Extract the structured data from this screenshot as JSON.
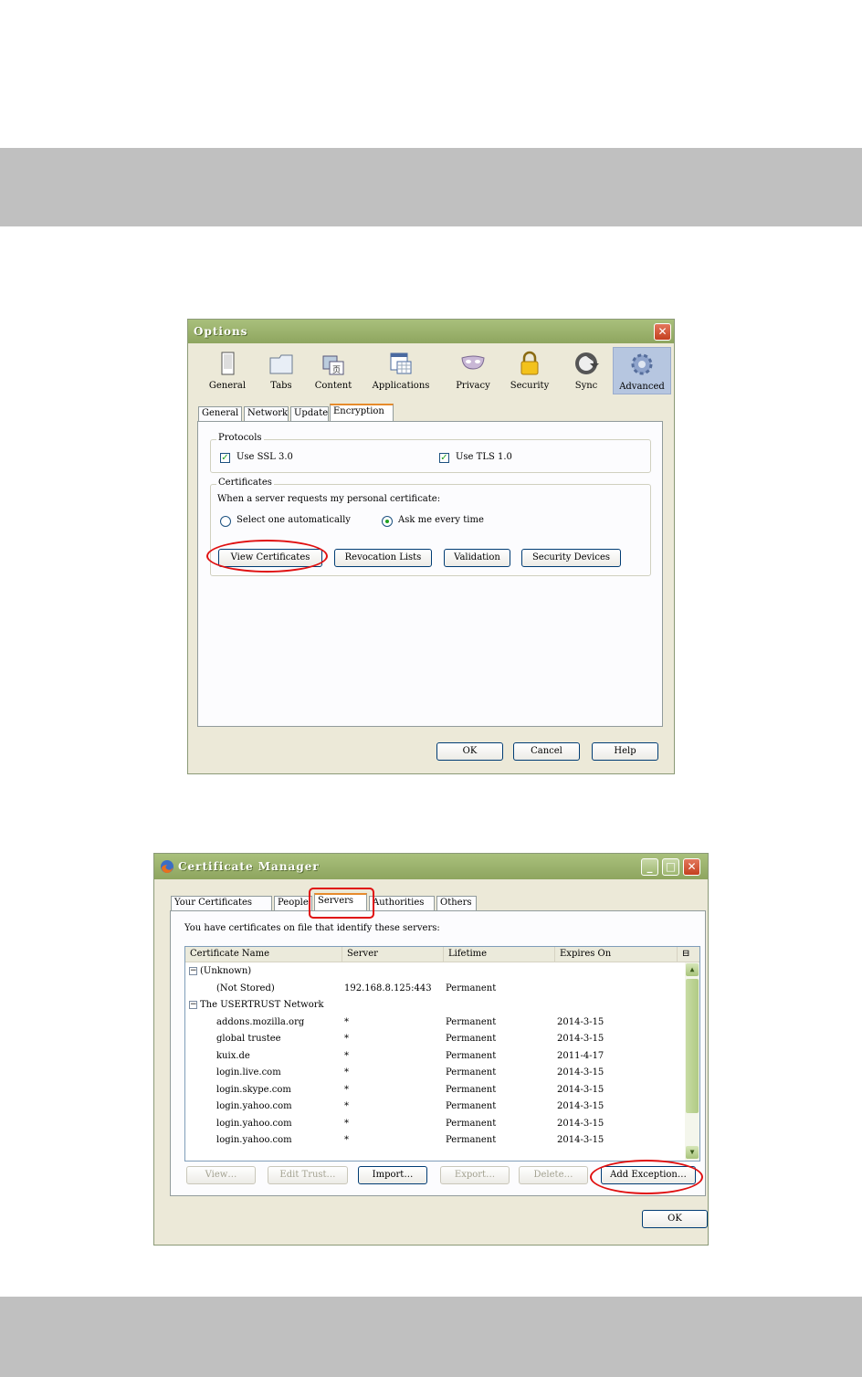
{
  "options": {
    "title": "Options",
    "toolbar": [
      {
        "label": "General",
        "icon": "general-icon"
      },
      {
        "label": "Tabs",
        "icon": "tabs-icon"
      },
      {
        "label": "Content",
        "icon": "content-icon"
      },
      {
        "label": "Applications",
        "icon": "applications-icon"
      },
      {
        "label": "Privacy",
        "icon": "privacy-mask-icon"
      },
      {
        "label": "Security",
        "icon": "padlock-icon"
      },
      {
        "label": "Sync",
        "icon": "sync-icon"
      },
      {
        "label": "Advanced",
        "icon": "gear-icon"
      }
    ],
    "tabs": [
      "General",
      "Network",
      "Update",
      "Encryption"
    ],
    "protocols": {
      "title": "Protocols",
      "ssl": {
        "label": "Use SSL 3.0",
        "checked": true
      },
      "tls": {
        "label": "Use TLS 1.0",
        "checked": true
      }
    },
    "certificates": {
      "title": "Certificates",
      "prompt": "When a server requests my personal certificate:",
      "radio_auto": "Select one automatically",
      "radio_ask": "Ask me every time",
      "selected": "Ask me every time",
      "buttons": [
        "View Certificates",
        "Revocation Lists",
        "Validation",
        "Security Devices"
      ]
    },
    "footer": {
      "ok": "OK",
      "cancel": "Cancel",
      "help": "Help"
    }
  },
  "cert_manager": {
    "title": "Certificate Manager",
    "tabs": [
      "Your Certificates",
      "People",
      "Servers",
      "Authorities",
      "Others"
    ],
    "description": "You have certificates on file that identify these servers:",
    "columns": [
      "Certificate Name",
      "Server",
      "Lifetime",
      "Expires On"
    ],
    "groups": [
      {
        "name": "(Unknown)",
        "rows": [
          {
            "name": "(Not Stored)",
            "server": "192.168.8.125:443",
            "lifetime": "Permanent",
            "expires": ""
          }
        ]
      },
      {
        "name": "The USERTRUST Network",
        "rows": [
          {
            "name": "addons.mozilla.org",
            "server": "*",
            "lifetime": "Permanent",
            "expires": "2014-3-15"
          },
          {
            "name": "global trustee",
            "server": "*",
            "lifetime": "Permanent",
            "expires": "2014-3-15"
          },
          {
            "name": "kuix.de",
            "server": "*",
            "lifetime": "Permanent",
            "expires": "2011-4-17"
          },
          {
            "name": "login.live.com",
            "server": "*",
            "lifetime": "Permanent",
            "expires": "2014-3-15"
          },
          {
            "name": "login.skype.com",
            "server": "*",
            "lifetime": "Permanent",
            "expires": "2014-3-15"
          },
          {
            "name": "login.yahoo.com",
            "server": "*",
            "lifetime": "Permanent",
            "expires": "2014-3-15"
          },
          {
            "name": "login.yahoo.com",
            "server": "*",
            "lifetime": "Permanent",
            "expires": "2014-3-15"
          },
          {
            "name": "login.yahoo.com",
            "server": "*",
            "lifetime": "Permanent",
            "expires": "2014-3-15"
          }
        ]
      }
    ],
    "buttons": {
      "view": "View…",
      "edit_trust": "Edit Trust…",
      "import": "Import…",
      "export": "Export…",
      "delete": "Delete…",
      "add_exception": "Add Exception…"
    },
    "ok": "OK"
  },
  "colors": {
    "highlight": "#e01010",
    "band": "#c0c0c0",
    "titlebar": "#9db66f"
  }
}
